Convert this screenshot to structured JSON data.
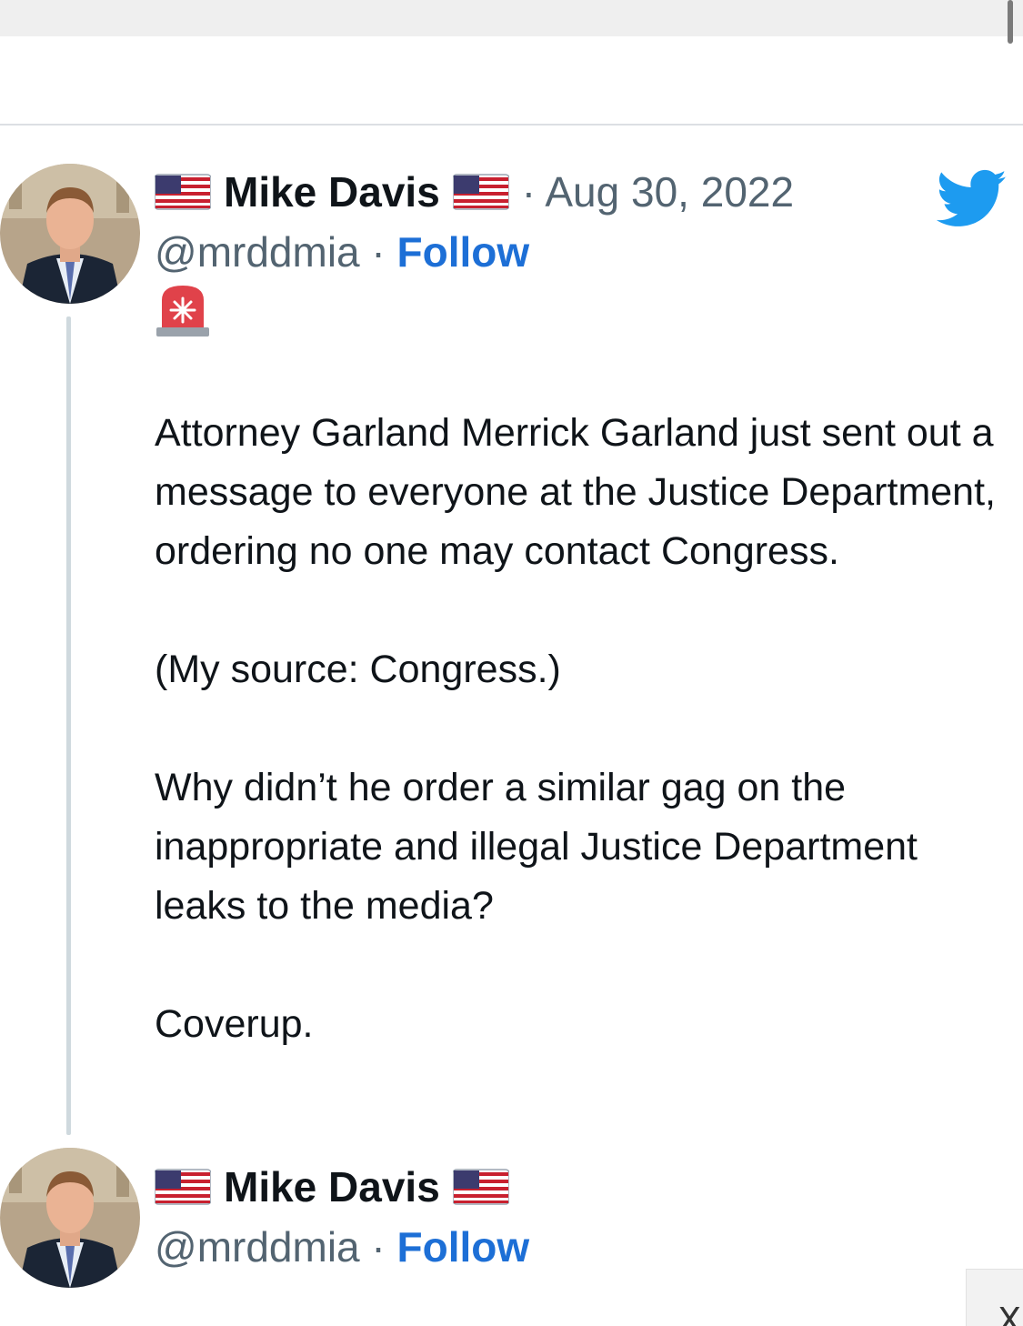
{
  "tweet": {
    "author_name": "Mike Davis",
    "handle": "@mrddmia",
    "separator": "·",
    "date": "Aug 30, 2022",
    "follow_label": "Follow",
    "prefix_emoji_icon": "rotating-light-icon",
    "flag_icon": "us-flag-icon",
    "paragraphs": [
      "Attorney Garland Merrick Garland just sent out a message to everyone at the Justice Department, ordering no one may contact Congress.",
      "(My source: Congress.)",
      "Why didn’t he order a similar gag on the inappropriate and illegal Justice Department leaks to the media?",
      "Coverup."
    ]
  },
  "reply": {
    "author_name": "Mike Davis",
    "handle": "@mrddmia",
    "separator": "·",
    "follow_label": "Follow"
  },
  "close_button": {
    "label": "X"
  },
  "colors": {
    "twitter_blue": "#1d9bf0",
    "follow_link": "#1d6fd6",
    "muted_text": "#536471",
    "thread_line": "#cfd9de"
  }
}
